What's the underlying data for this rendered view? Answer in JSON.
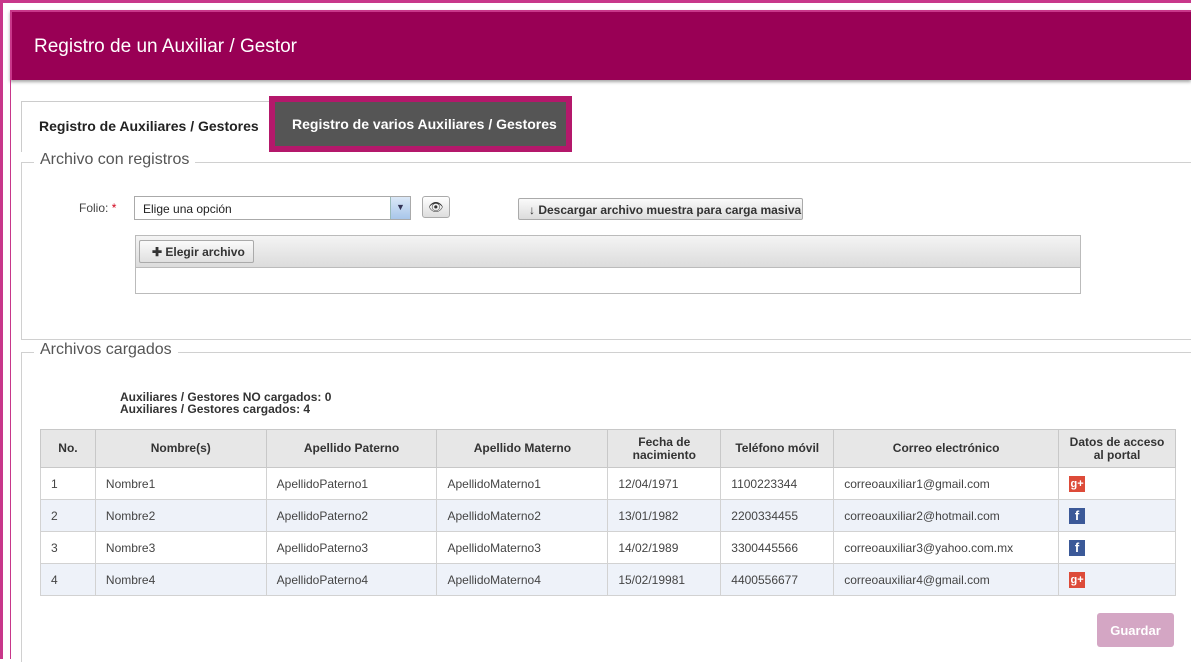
{
  "header": {
    "title": "Registro de un Auxiliar / Gestor"
  },
  "tabs": [
    {
      "label": "Registro de Auxiliares / Gestores"
    },
    {
      "label": "Registro de varios Auxiliares / Gestores"
    }
  ],
  "archivo": {
    "legend": "Archivo con registros",
    "folio_label": "Folio:",
    "required_mark": "*",
    "folio_value": "Elige una opción",
    "download_label": "Descargar archivo muestra para carga masiva",
    "choose_label": "Elegir archivo"
  },
  "cargados": {
    "legend": "Archivos cargados",
    "no_cargados": "Auxiliares / Gestores NO cargados: 0",
    "cargados": "Auxiliares / Gestores cargados: 4"
  },
  "table": {
    "headers": {
      "no": "No.",
      "nombre": "Nombre(s)",
      "paterno": "Apellido Paterno",
      "materno": "Apellido Materno",
      "fecha": "Fecha de nacimiento",
      "telefono": "Teléfono móvil",
      "correo": "Correo electrónico",
      "acceso": "Datos de acceso al portal"
    },
    "rows": [
      {
        "no": "1",
        "nombre": "Nombre1",
        "paterno": "ApellidoPaterno1",
        "materno": "ApellidoMaterno1",
        "fecha": "12/04/1971",
        "telefono": "1100223344",
        "correo": "correoauxiliar1@gmail.com",
        "acceso_icon": "google-plus-icon"
      },
      {
        "no": "2",
        "nombre": "Nombre2",
        "paterno": "ApellidoPaterno2",
        "materno": "ApellidoMaterno2",
        "fecha": "13/01/1982",
        "telefono": "2200334455",
        "correo": "correoauxiliar2@hotmail.com",
        "acceso_icon": "facebook-icon"
      },
      {
        "no": "3",
        "nombre": "Nombre3",
        "paterno": "ApellidoPaterno3",
        "materno": "ApellidoMaterno3",
        "fecha": "14/02/1989",
        "telefono": "3300445566",
        "correo": "correoauxiliar3@yahoo.com.mx",
        "acceso_icon": "facebook-icon"
      },
      {
        "no": "4",
        "nombre": "Nombre4",
        "paterno": "ApellidoPaterno4",
        "materno": "ApellidoMaterno4",
        "fecha": "15/02/19981",
        "telefono": "4400556677",
        "correo": "correoauxiliar4@gmail.com",
        "acceso_icon": "google-plus-icon"
      }
    ]
  },
  "save_label": "Guardar",
  "colors": {
    "brand": "#990055",
    "tab_active": "#555555",
    "save_disabled": "#d4a6c4",
    "google": "#dd4b39",
    "facebook": "#3b5998"
  }
}
